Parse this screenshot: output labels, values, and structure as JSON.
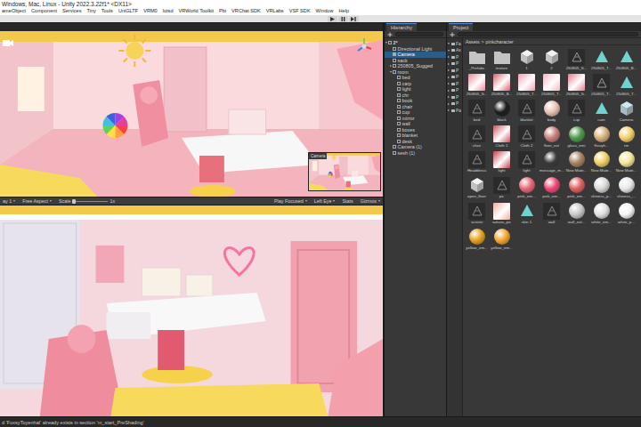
{
  "window": {
    "title": "Windows, Mac, Linux - Unity 2022.3.22f1* <DX11>"
  },
  "menu": [
    "ameObject",
    "Component",
    "Services",
    "Tiny",
    "Tools",
    "UniGLTF",
    "VRM0",
    "lotsd",
    "VRWorld Toolkit",
    "Pbi",
    "VRChat SDK",
    "VRLabs",
    "VSF SDK",
    "Window",
    "Help"
  ],
  "scene": {
    "inset_label": "Camera"
  },
  "game": {
    "display": "ay 1",
    "aspect": "Free Aspect",
    "scale_label": "Scale",
    "scale_value": "1x",
    "scale_level": 0.05,
    "play_mode": "Play Focused",
    "eye": "Left Eye",
    "stats": "Stats",
    "gizmos": "Gizmos"
  },
  "hierarchy": {
    "title": "Hierarchy",
    "items": [
      {
        "label": "2*",
        "depth": 0,
        "has_children": true,
        "expanded": true,
        "selected": false
      },
      {
        "label": "Directional Light",
        "depth": 1,
        "has_children": false,
        "expanded": false,
        "selected": false
      },
      {
        "label": "Camera",
        "depth": 1,
        "has_children": false,
        "expanded": false,
        "selected": true
      },
      {
        "label": "sack",
        "depth": 1,
        "has_children": false,
        "expanded": false,
        "selected": false
      },
      {
        "label": "250805_Sugged",
        "depth": 1,
        "has_children": true,
        "expanded": false,
        "selected": false
      },
      {
        "label": "room",
        "depth": 1,
        "has_children": true,
        "expanded": true,
        "selected": false
      },
      {
        "label": "bed",
        "depth": 2,
        "has_children": false,
        "expanded": false,
        "selected": false
      },
      {
        "label": "carp",
        "depth": 2,
        "has_children": false,
        "expanded": false,
        "selected": false
      },
      {
        "label": "light",
        "depth": 2,
        "has_children": false,
        "expanded": false,
        "selected": false
      },
      {
        "label": "chr",
        "depth": 2,
        "has_children": false,
        "expanded": false,
        "selected": false
      },
      {
        "label": "book",
        "depth": 2,
        "has_children": false,
        "expanded": false,
        "selected": false
      },
      {
        "label": "chair",
        "depth": 2,
        "has_children": false,
        "expanded": false,
        "selected": false
      },
      {
        "label": "cup",
        "depth": 2,
        "has_children": false,
        "expanded": false,
        "selected": false
      },
      {
        "label": "mirror",
        "depth": 2,
        "has_children": false,
        "expanded": false,
        "selected": false
      },
      {
        "label": "wall",
        "depth": 2,
        "has_children": false,
        "expanded": false,
        "selected": false
      },
      {
        "label": "boxes",
        "depth": 2,
        "has_children": false,
        "expanded": false,
        "selected": false
      },
      {
        "label": "blanket",
        "depth": 2,
        "has_children": false,
        "expanded": false,
        "selected": false
      },
      {
        "label": "desk",
        "depth": 2,
        "has_children": false,
        "expanded": false,
        "selected": false
      },
      {
        "label": "Camera (1)",
        "depth": 1,
        "has_children": false,
        "expanded": false,
        "selected": false
      },
      {
        "label": "sesh (1)",
        "depth": 1,
        "has_children": false,
        "expanded": false,
        "selected": false
      }
    ]
  },
  "project": {
    "title": "Project",
    "breadcrumb": [
      "Assets",
      "pinkcharacter"
    ],
    "separator": ">",
    "tree": [
      {
        "label": "Fa",
        "expanded": true
      },
      {
        "label": "As",
        "expanded": true
      },
      {
        "label": "P",
        "expanded": false
      },
      {
        "label": "P",
        "expanded": false
      },
      {
        "label": "P",
        "expanded": false
      },
      {
        "label": "P",
        "expanded": false
      },
      {
        "label": "P",
        "expanded": false
      },
      {
        "label": "P",
        "expanded": false
      },
      {
        "label": "P",
        "expanded": false
      },
      {
        "label": "P",
        "expanded": false
      },
      {
        "label": "Pa",
        "expanded": false
      }
    ],
    "assets": [
      {
        "label": "_Prefabs",
        "kind": "folder",
        "color": "#c4c4c4"
      },
      {
        "label": "texture",
        "kind": "folder",
        "color": "#c4c4c4"
      },
      {
        "label": "1",
        "kind": "prefab",
        "color": "#f2f2f2"
      },
      {
        "label": "2",
        "kind": "prefab",
        "color": "#f2f2f2"
      },
      {
        "label": "250805_S...",
        "kind": "mesh",
        "color": "#9a9a9a"
      },
      {
        "label": "250805_T...",
        "kind": "model",
        "color": "#6fd3cf"
      },
      {
        "label": "250805_B...",
        "kind": "model",
        "color": "#6fd3cf"
      },
      {
        "label": "250805_S...",
        "kind": "texture",
        "color": "#e98a9a"
      },
      {
        "label": "250805_B...",
        "kind": "texture",
        "color": "#d9606e"
      },
      {
        "label": "250805_T...",
        "kind": "texture",
        "color": "#ef9fb0"
      },
      {
        "label": "250805_T...",
        "kind": "texture",
        "color": "#f2b6c2"
      },
      {
        "label": "250805_S...",
        "kind": "texture",
        "color": "#e67c8e"
      },
      {
        "label": "250805_T...",
        "kind": "mesh",
        "color": "#9a9a9a"
      },
      {
        "label": "250805_T...",
        "kind": "model",
        "color": "#6fd3cf"
      },
      {
        "label": "bed",
        "kind": "mesh",
        "color": "#8a8a8a"
      },
      {
        "label": "black",
        "kind": "material",
        "color": "#1c1c1c"
      },
      {
        "label": "blanket",
        "kind": "mesh",
        "color": "#8a8a8a"
      },
      {
        "label": "body",
        "kind": "material",
        "color": "#e9c2b4"
      },
      {
        "label": "cup",
        "kind": "mesh",
        "color": "#8a8a8a"
      },
      {
        "label": "cam",
        "kind": "model",
        "color": "#6fd3cf"
      },
      {
        "label": "Camera",
        "kind": "prefab",
        "color": "#cfe8f2"
      },
      {
        "label": "chair",
        "kind": "mesh",
        "color": "#8a8a8a"
      },
      {
        "label": "Cloth 1",
        "kind": "texture",
        "color": "#c9505e"
      },
      {
        "label": "Cloth 2",
        "kind": "mesh",
        "color": "#8a8a8a"
      },
      {
        "label": "floor_ext",
        "kind": "material",
        "color": "#c8807a"
      },
      {
        "label": "glass_emi",
        "kind": "material",
        "color": "#4e9a4a"
      },
      {
        "label": "Kouyh...",
        "kind": "material",
        "color": "#d8b078"
      },
      {
        "label": "rm",
        "kind": "material",
        "color": "#f3d06a"
      },
      {
        "label": "Headdress",
        "kind": "mesh",
        "color": "#8a8a8a"
      },
      {
        "label": "light",
        "kind": "texture",
        "color": "#c0404e"
      },
      {
        "label": "light",
        "kind": "mesh",
        "color": "#8a8a8a"
      },
      {
        "label": "message_m...",
        "kind": "material",
        "color": "#3a3a3a"
      },
      {
        "label": "New Mate...",
        "kind": "material",
        "color": "#a88462"
      },
      {
        "label": "New Mate...",
        "kind": "material",
        "color": "#f0d060"
      },
      {
        "label": "New Mate...",
        "kind": "material",
        "color": "#f5e79a"
      },
      {
        "label": "open_floor",
        "kind": "prefab",
        "color": "#f2f2f2"
      },
      {
        "label": "pic",
        "kind": "mesh",
        "color": "#8a8a8a"
      },
      {
        "label": "pink_em...",
        "kind": "material",
        "color": "#e86878"
      },
      {
        "label": "pink_em...",
        "kind": "material",
        "color": "#f04878"
      },
      {
        "label": "pink_em...",
        "kind": "material",
        "color": "#e06060"
      },
      {
        "label": "shiness_p...",
        "kind": "material",
        "color": "#d8d8d8"
      },
      {
        "label": "shiness_...",
        "kind": "material",
        "color": "#e8e8e8"
      },
      {
        "label": "screen",
        "kind": "mesh",
        "color": "#8a8a8a"
      },
      {
        "label": "sakura_pic",
        "kind": "texture",
        "color": "#eab0a0"
      },
      {
        "label": "skin 1",
        "kind": "model",
        "color": "#6fd3cf"
      },
      {
        "label": "wall",
        "kind": "mesh",
        "color": "#8a8a8a"
      },
      {
        "label": "wall_ext...",
        "kind": "material",
        "color": "#c8c8c8"
      },
      {
        "label": "white_em...",
        "kind": "material",
        "color": "#e0e0e0"
      },
      {
        "label": "white_p...",
        "kind": "material",
        "color": "#f4f4f4"
      },
      {
        "label": "yellow_em...",
        "kind": "material",
        "color": "#e8a020"
      },
      {
        "label": "yellow_em...",
        "kind": "material",
        "color": "#f5a830"
      }
    ]
  },
  "status_bar": {
    "message": "d 'FoxsyToyenhal' already exists in section 'm_start_PreShading'"
  }
}
